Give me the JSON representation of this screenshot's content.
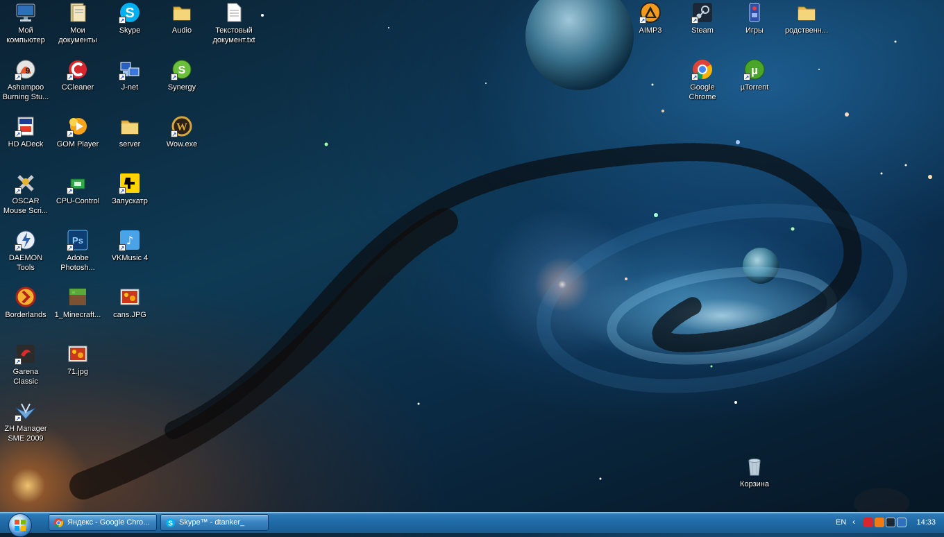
{
  "desktop": {
    "icons": [
      {
        "label": "Мой компьютер",
        "icon": "my-computer-icon",
        "shortcut": false
      },
      {
        "label": "Мои документы",
        "icon": "my-documents-icon",
        "shortcut": false
      },
      {
        "label": "Skype",
        "icon": "skype-icon",
        "shortcut": true
      },
      {
        "label": "Audio",
        "icon": "folder-icon",
        "shortcut": false
      },
      {
        "label": "Текстовый документ.txt",
        "icon": "text-document-icon",
        "shortcut": false
      },
      {
        "label": "Ashampoo Burning Stu...",
        "icon": "ashampoo-icon",
        "shortcut": true
      },
      {
        "label": "CCleaner",
        "icon": "ccleaner-icon",
        "shortcut": true
      },
      {
        "label": "J-net",
        "icon": "jnet-icon",
        "shortcut": true
      },
      {
        "label": "Synergy",
        "icon": "synergy-icon",
        "shortcut": true
      },
      {
        "label": "HD ADeck",
        "icon": "hd-adeck-icon",
        "shortcut": true
      },
      {
        "label": "GOM Player",
        "icon": "gom-player-icon",
        "shortcut": true
      },
      {
        "label": "server",
        "icon": "folder-icon",
        "shortcut": false
      },
      {
        "label": "Wow.exe",
        "icon": "wow-icon",
        "shortcut": true
      },
      {
        "label": "OSCAR Mouse Scri...",
        "icon": "oscar-icon",
        "shortcut": true
      },
      {
        "label": "CPU-Control",
        "icon": "cpu-control-icon",
        "shortcut": true
      },
      {
        "label": "Запускатр",
        "icon": "launcher-icon",
        "shortcut": true
      },
      {
        "label": "DAEMON Tools",
        "icon": "daemon-tools-icon",
        "shortcut": true
      },
      {
        "label": "Adobe Photosh...",
        "icon": "photoshop-icon",
        "shortcut": true
      },
      {
        "label": "VKMusic 4",
        "icon": "vkmusic-icon",
        "shortcut": true
      },
      {
        "label": "Borderlands",
        "icon": "borderlands-icon",
        "shortcut": false
      },
      {
        "label": "1_Minecraft...",
        "icon": "minecraft-icon",
        "shortcut": false
      },
      {
        "label": "cans.JPG",
        "icon": "image-file-icon",
        "shortcut": false
      },
      {
        "label": "Garena Classic",
        "icon": "garena-icon",
        "shortcut": true
      },
      {
        "label": "71.jpg",
        "icon": "image-file-icon",
        "shortcut": false
      },
      {
        "label": "ZH Manager SME 2009",
        "icon": "zh-manager-icon",
        "shortcut": true
      },
      {
        "label": "AIMP3",
        "icon": "aimp-icon",
        "shortcut": true
      },
      {
        "label": "Steam",
        "icon": "steam-icon",
        "shortcut": true
      },
      {
        "label": "Игры",
        "icon": "games-icon",
        "shortcut": false
      },
      {
        "label": "родственн...",
        "icon": "folder-icon",
        "shortcut": false
      },
      {
        "label": "Google Chrome",
        "icon": "chrome-icon",
        "shortcut": true
      },
      {
        "label": "µTorrent",
        "icon": "utorrent-icon",
        "shortcut": true
      },
      {
        "label": "Корзина",
        "icon": "recycle-bin-icon",
        "shortcut": false
      }
    ]
  },
  "taskbar": {
    "start": {
      "icon": "windows-start-icon"
    },
    "buttons": [
      {
        "label": "Яндекс - Google Chro...",
        "icon": "chrome-icon"
      },
      {
        "label": "Skype™ - dtanker_",
        "icon": "skype-icon"
      }
    ],
    "tray": {
      "language": "EN",
      "show_hidden": "‹",
      "clock": "14:33"
    }
  }
}
